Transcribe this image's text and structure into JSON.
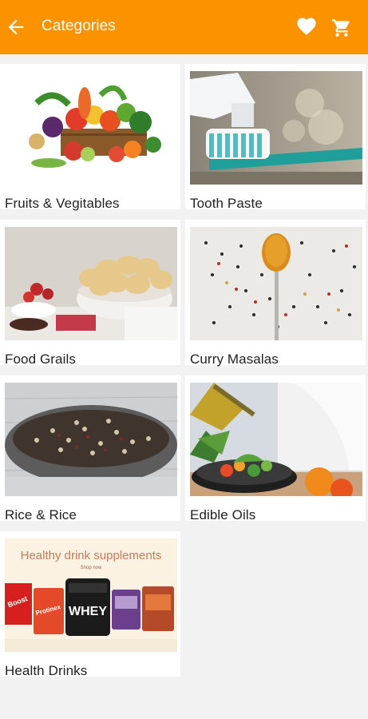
{
  "header": {
    "title": "Categories",
    "back_icon": "arrow-left-icon",
    "favorite_icon": "heart-icon",
    "cart_icon": "shopping-cart-icon",
    "bar_color": "#fb9200"
  },
  "categories": [
    {
      "label": "Fruits & Vegitables"
    },
    {
      "label": "Tooth Paste"
    },
    {
      "label": "Food Grails"
    },
    {
      "label": "Curry Masalas"
    },
    {
      "label": "Rice & Rice"
    },
    {
      "label": "Edible Oils"
    },
    {
      "label": "Health Drinks",
      "banner_text": "Healthy drink supplements",
      "banner_sub": "Shop now",
      "product_text": "WHEY"
    }
  ]
}
